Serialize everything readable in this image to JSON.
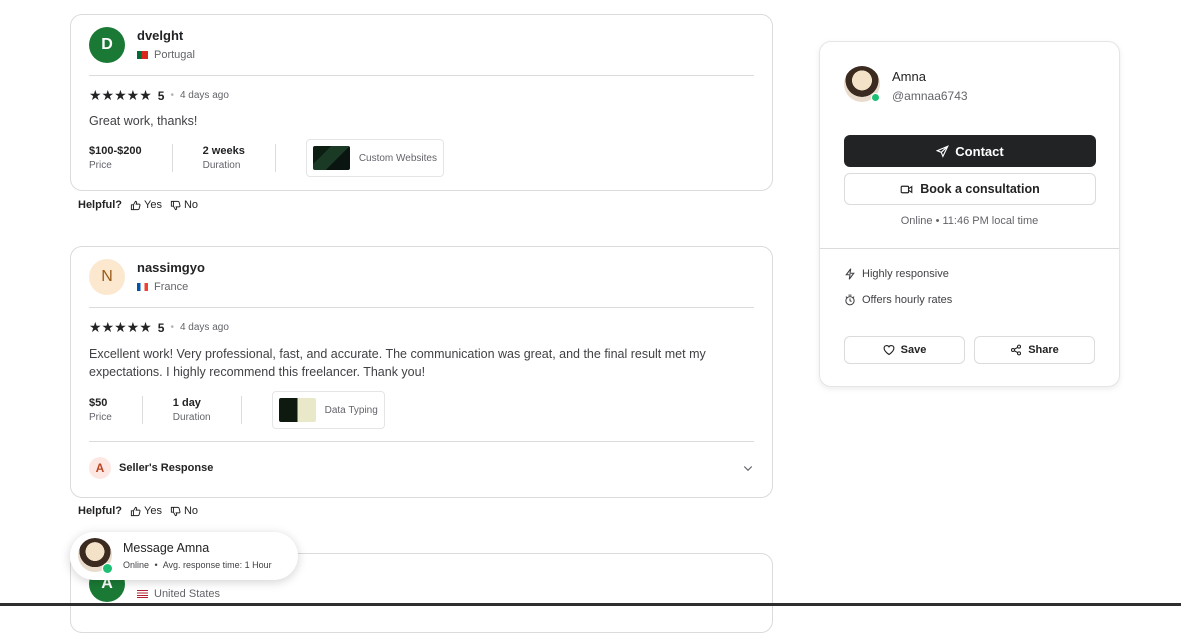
{
  "reviews": [
    {
      "initial": "D",
      "avatar_bg": "#1a7a35",
      "avatar_fg": "#ffffff",
      "name": "dvelght",
      "country": "Portugal",
      "rating": "5",
      "ago": "4 days ago",
      "text": "Great work, thanks!",
      "price_value": "$100-$200",
      "price_label": "Price",
      "duration_value": "2 weeks",
      "duration_label": "Duration",
      "gig_title": "Custom Websites"
    },
    {
      "initial": "N",
      "avatar_bg": "#fbe8cf",
      "avatar_fg": "#9b5a16",
      "name": "nassimgyo",
      "country": "France",
      "rating": "5",
      "ago": "4 days ago",
      "text": "Excellent work! Very professional, fast, and accurate. The communication was great, and the final result met my expectations. I highly recommend this freelancer. Thank you!",
      "price_value": "$50",
      "price_label": "Price",
      "duration_value": "1 day",
      "duration_label": "Duration",
      "gig_title": "Data Typing",
      "seller_response_initial": "A",
      "seller_response_label": "Seller's Response"
    },
    {
      "initial": "A",
      "avatar_bg": "#1a7a35",
      "avatar_fg": "#ffffff",
      "country": "United States"
    }
  ],
  "helpful": {
    "label": "Helpful?",
    "yes": "Yes",
    "no": "No"
  },
  "seller": {
    "name": "Amna",
    "handle": "@amnaa6743",
    "contact_label": "Contact",
    "consult_label": "Book a consultation",
    "online_text": "Online • 11:46 PM local time",
    "feature_1": "Highly responsive",
    "feature_2": "Offers hourly rates",
    "save_label": "Save",
    "share_label": "Share"
  },
  "message_bubble": {
    "title": "Message Amna",
    "status": "Online",
    "response": "Avg. response time: 1 Hour"
  }
}
